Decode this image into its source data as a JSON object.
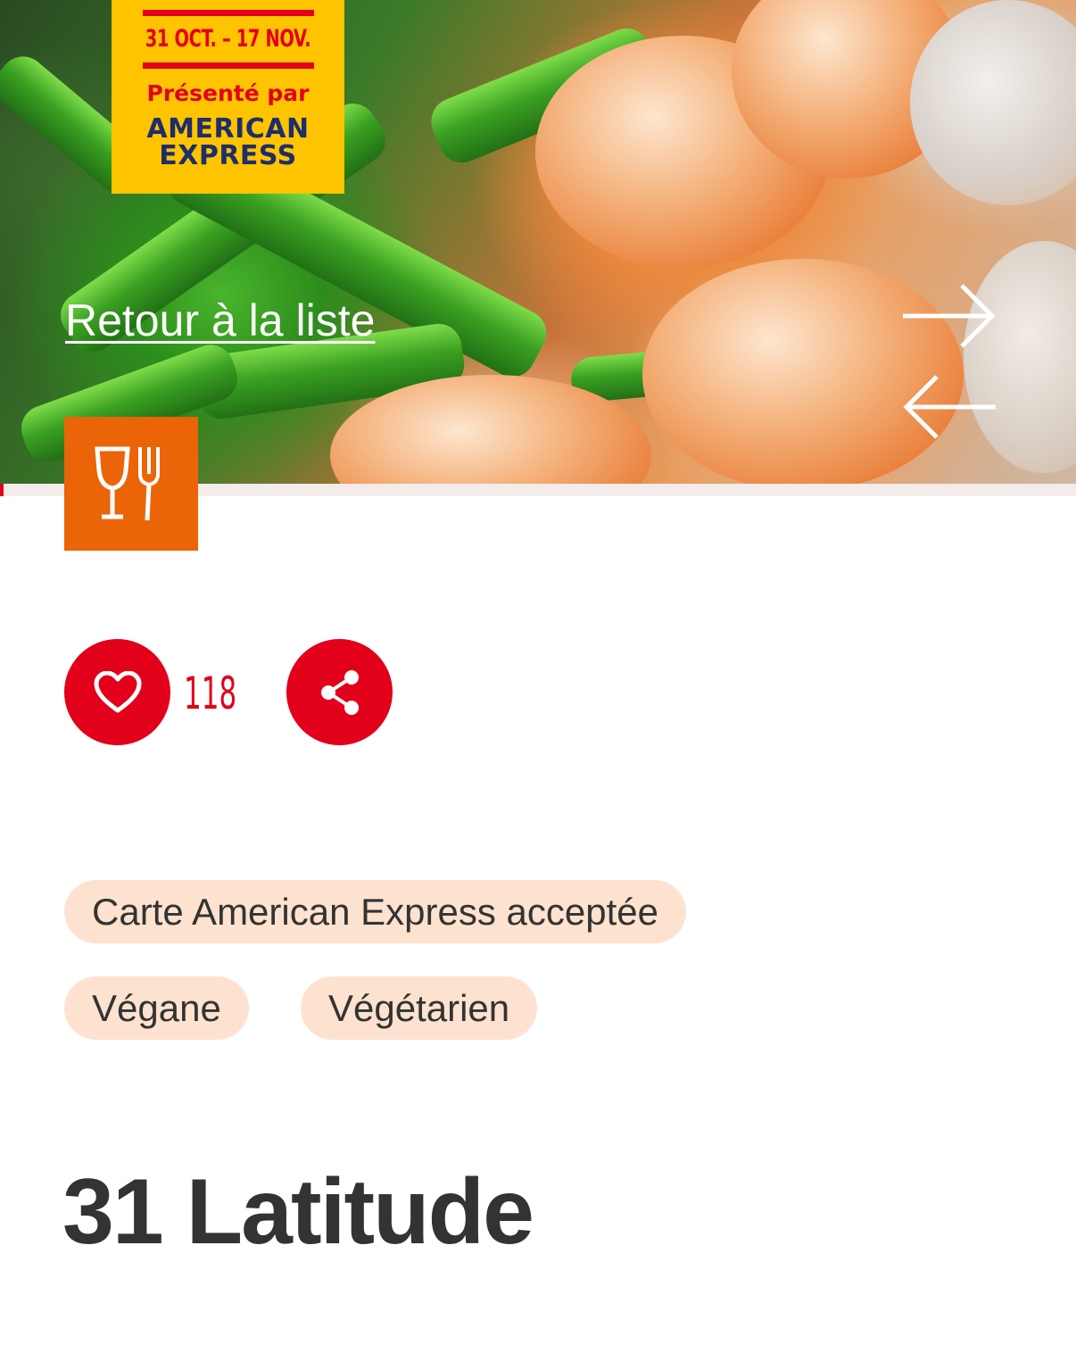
{
  "promo_badge": {
    "dates": "31 OCT. – 17 NOV.",
    "presented_by": "Présenté par",
    "sponsor_line1": "AMERICAN",
    "sponsor_line2": "EXPRESS",
    "colors": {
      "background": "#ffc400",
      "accent": "#e2001a",
      "sponsor": "#1d2e6b"
    }
  },
  "hero": {
    "back_link": "Retour à la liste",
    "next_icon": "arrow-right-icon",
    "prev_icon": "arrow-left-icon"
  },
  "category": {
    "icon": "glass-and-fork-icon",
    "color": "#eb6407"
  },
  "actions": {
    "like_icon": "heart-icon",
    "like_count": "118",
    "share_icon": "share-icon",
    "color": "#e2001a"
  },
  "tags": [
    {
      "label": "Carte American Express acceptée"
    },
    {
      "label": "Végane"
    },
    {
      "label": "Végétarien"
    }
  ],
  "restaurant": {
    "name": "31 Latitude"
  }
}
